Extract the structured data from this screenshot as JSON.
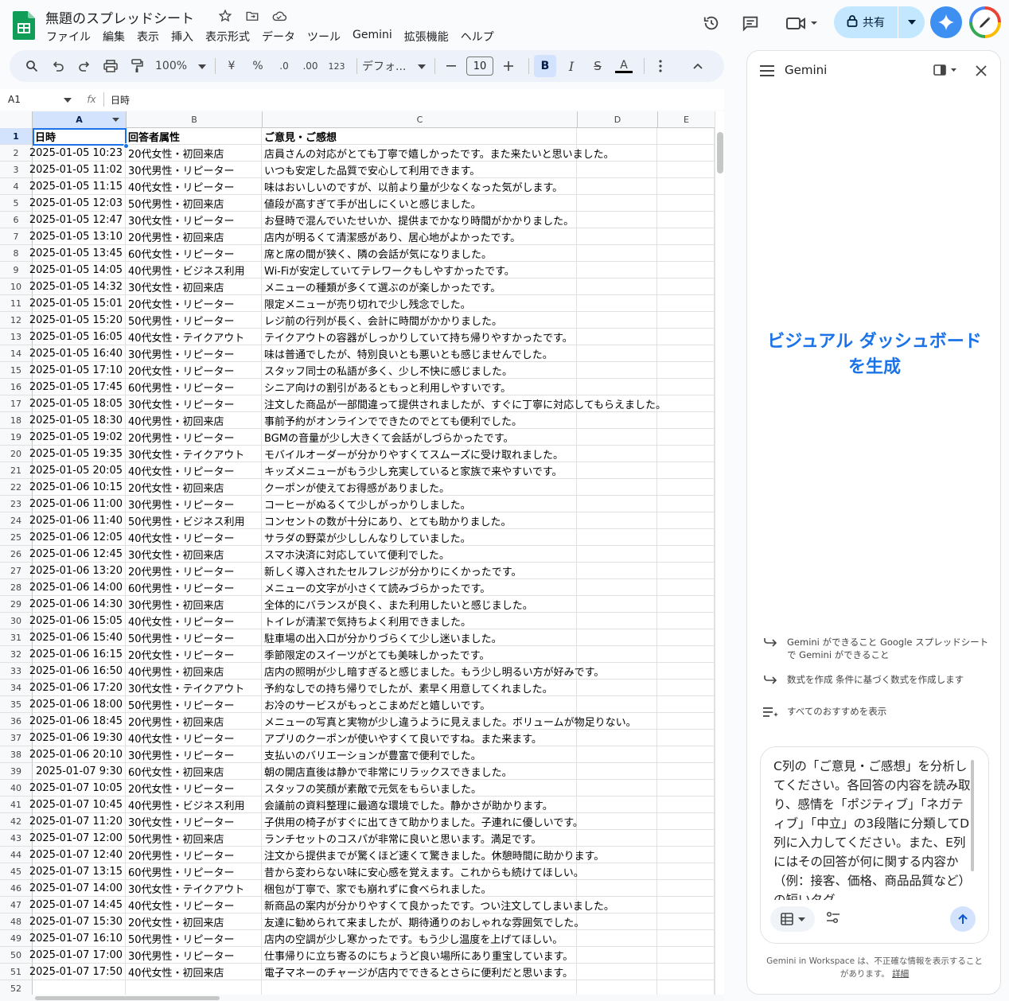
{
  "app": {
    "title": "無題のスプレッドシート"
  },
  "menu": [
    "ファイル",
    "編集",
    "表示",
    "挿入",
    "表示形式",
    "データ",
    "ツール",
    "Gemini",
    "拡張機能",
    "ヘルプ"
  ],
  "header": {
    "share_label": "共有"
  },
  "toolbar": {
    "zoom": "100%",
    "currency": "¥",
    "percent": "%",
    "dec_less": ".0",
    "dec_more": ".00",
    "format_123": "123",
    "font": "デフォ...",
    "font_size": "10",
    "bold": "B",
    "italic": "I",
    "strike": "S",
    "text_color": "A"
  },
  "formula_bar": {
    "cell_ref": "A1",
    "fx": "fx",
    "value": "日時"
  },
  "grid": {
    "columns": [
      "A",
      "B",
      "C",
      "D",
      "E"
    ],
    "header": [
      "日時",
      "回答者属性",
      "ご意見・ご感想"
    ],
    "rows": [
      [
        "2025-01-05 10:23",
        "20代女性・初回来店",
        "店員さんの対応がとても丁寧で嬉しかったです。また来たいと思いました。"
      ],
      [
        "2025-01-05 11:02",
        "30代男性・リピーター",
        "いつも安定した品質で安心して利用できます。"
      ],
      [
        "2025-01-05 11:15",
        "40代女性・リピーター",
        "味はおいしいのですが、以前より量が少なくなった気がします。"
      ],
      [
        "2025-01-05 12:03",
        "50代男性・初回来店",
        "値段が高すぎて手が出しにくいと感じました。"
      ],
      [
        "2025-01-05 12:47",
        "30代女性・リピーター",
        "お昼時で混んでいたせいか、提供までかなり時間がかかりました。"
      ],
      [
        "2025-01-05 13:10",
        "20代男性・初回来店",
        "店内が明るくて清潔感があり、居心地がよかったです。"
      ],
      [
        "2025-01-05 13:45",
        "60代女性・リピーター",
        "席と席の間が狭く、隣の会話が気になりました。"
      ],
      [
        "2025-01-05 14:05",
        "40代男性・ビジネス利用",
        "Wi-Fiが安定していてテレワークもしやすかったです。"
      ],
      [
        "2025-01-05 14:32",
        "30代女性・初回来店",
        "メニューの種類が多くて選ぶのが楽しかったです。"
      ],
      [
        "2025-01-05 15:01",
        "20代女性・リピーター",
        "限定メニューが売り切れで少し残念でした。"
      ],
      [
        "2025-01-05 15:20",
        "50代男性・リピーター",
        "レジ前の行列が長く、会計に時間がかかりました。"
      ],
      [
        "2025-01-05 16:05",
        "40代女性・テイクアウト",
        "テイクアウトの容器がしっかりしていて持ち帰りやすかったです。"
      ],
      [
        "2025-01-05 16:40",
        "30代男性・リピーター",
        "味は普通でしたが、特別良いとも悪いとも感じませんでした。"
      ],
      [
        "2025-01-05 17:10",
        "20代女性・リピーター",
        "スタッフ同士の私語が多く、少し不快に感じました。"
      ],
      [
        "2025-01-05 17:45",
        "60代男性・リピーター",
        "シニア向けの割引があるともっと利用しやすいです。"
      ],
      [
        "2025-01-05 18:05",
        "30代女性・リピーター",
        "注文した商品が一部間違って提供されましたが、すぐに丁寧に対応してもらえました。"
      ],
      [
        "2025-01-05 18:30",
        "40代男性・初回来店",
        "事前予約がオンラインでできたのでとても便利でした。"
      ],
      [
        "2025-01-05 19:02",
        "20代男性・リピーター",
        "BGMの音量が少し大きくて会話がしづらかったです。"
      ],
      [
        "2025-01-05 19:35",
        "30代女性・テイクアウト",
        "モバイルオーダーが分かりやすくてスムーズに受け取れました。"
      ],
      [
        "2025-01-05 20:05",
        "40代女性・リピーター",
        "キッズメニューがもう少し充実していると家族で来やすいです。"
      ],
      [
        "2025-01-06 10:15",
        "20代女性・初回来店",
        "クーポンが使えてお得感がありました。"
      ],
      [
        "2025-01-06 11:00",
        "30代男性・リピーター",
        "コーヒーがぬるくて少しがっかりしました。"
      ],
      [
        "2025-01-06 11:40",
        "50代男性・ビジネス利用",
        "コンセントの数が十分にあり、とても助かりました。"
      ],
      [
        "2025-01-06 12:05",
        "40代女性・リピーター",
        "サラダの野菜が少ししんなりしていました。"
      ],
      [
        "2025-01-06 12:45",
        "30代女性・初回来店",
        "スマホ決済に対応していて便利でした。"
      ],
      [
        "2025-01-06 13:20",
        "20代男性・リピーター",
        "新しく導入されたセルフレジが分かりにくかったです。"
      ],
      [
        "2025-01-06 14:00",
        "60代男性・リピーター",
        "メニューの文字が小さくて読みづらかったです。"
      ],
      [
        "2025-01-06 14:30",
        "30代男性・初回来店",
        "全体的にバランスが良く、また利用したいと感じました。"
      ],
      [
        "2025-01-06 15:05",
        "40代女性・リピーター",
        "トイレが清潔で気持ちよく利用できました。"
      ],
      [
        "2025-01-06 15:40",
        "50代男性・リピーター",
        "駐車場の出入口が分かりづらくて少し迷いました。"
      ],
      [
        "2025-01-06 16:15",
        "20代女性・リピーター",
        "季節限定のスイーツがとても美味しかったです。"
      ],
      [
        "2025-01-06 16:50",
        "40代男性・初回来店",
        "店内の照明が少し暗すぎると感じました。もう少し明るい方が好みです。"
      ],
      [
        "2025-01-06 17:20",
        "30代女性・テイクアウト",
        "予約なしでの持ち帰りでしたが、素早く用意してくれました。"
      ],
      [
        "2025-01-06 18:00",
        "50代男性・リピーター",
        "お冷のサービスがもっとこまめだと嬉しいです。"
      ],
      [
        "2025-01-06 18:45",
        "20代男性・初回来店",
        "メニューの写真と実物が少し違うように見えました。ボリュームが物足りない。"
      ],
      [
        "2025-01-06 19:30",
        "40代女性・リピーター",
        "アプリのクーポンが使いやすくて良いですね。また来ます。"
      ],
      [
        "2025-01-06 20:10",
        "30代男性・リピーター",
        "支払いのバリエーションが豊富で便利でした。"
      ],
      [
        "2025-01-07 9:30",
        "60代女性・初回来店",
        "朝の開店直後は静かで非常にリラックスできました。"
      ],
      [
        "2025-01-07 10:05",
        "20代女性・リピーター",
        "スタッフの笑顔が素敵で元気をもらいました。"
      ],
      [
        "2025-01-07 10:45",
        "40代男性・ビジネス利用",
        "会議前の資料整理に最適な環境でした。静かさが助かります。"
      ],
      [
        "2025-01-07 11:20",
        "30代女性・リピーター",
        "子供用の椅子がすぐに出てきて助かりました。子連れに優しいです。"
      ],
      [
        "2025-01-07 12:00",
        "50代男性・初回来店",
        "ランチセットのコスパが非常に良いと思います。満足です。"
      ],
      [
        "2025-01-07 12:40",
        "20代男性・リピーター",
        "注文から提供までが驚くほど速くて驚きました。休憩時間に助かります。"
      ],
      [
        "2025-01-07 13:15",
        "60代男性・リピーター",
        "昔から変わらない味に安心感を覚えます。これからも続けてほしい。"
      ],
      [
        "2025-01-07 14:00",
        "30代女性・テイクアウト",
        "梱包が丁寧で、家でも崩れずに食べられました。"
      ],
      [
        "2025-01-07 14:45",
        "40代女性・リピーター",
        "新商品の案内が分かりやすくて良かったです。つい注文してしまいました。"
      ],
      [
        "2025-01-07 15:30",
        "20代女性・初回来店",
        "友達に勧められて来ましたが、期待通りのおしゃれな雰囲気でした。"
      ],
      [
        "2025-01-07 16:10",
        "50代男性・リピーター",
        "店内の空調が少し寒かったです。もう少し温度を上げてほしい。"
      ],
      [
        "2025-01-07 17:00",
        "30代男性・リピーター",
        "仕事帰りに立ち寄るのにちょうど良い場所にあり重宝しています。"
      ],
      [
        "2025-01-07 17:50",
        "40代女性・初回来店",
        "電子マネーのチャージが店内でできるとさらに便利だと思います。"
      ]
    ]
  },
  "gemini": {
    "title": "Gemini",
    "hero": "ビジュアル ダッシュボードを生成",
    "suggestions": [
      "Gemini ができること Google スプレッドシートで Gemini ができること",
      "数式を作成 条件に基づく数式を作成します",
      "すべてのおすすめを表示"
    ],
    "prompt": "C列の「ご意見・ご感想」を分析してください。各回答の内容を読み取り、感情を「ポジティブ」「ネガティブ」「中立」の3段階に分類してD列に入力してください。また、E列にはその回答が何に関する内容か（例：接客、価格、商品品質など）の短いタグ",
    "disclaimer": "Gemini in Workspace は、不正確な情報を表示することがあります。",
    "disclaimer_link": "詳細"
  }
}
